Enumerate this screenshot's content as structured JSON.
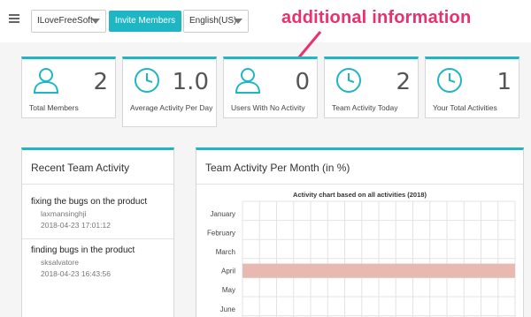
{
  "header": {
    "team_select": "ILoveFreeSoft",
    "invite_button": "Invite Members",
    "language_select": "English(US)"
  },
  "annotation": "additional information",
  "stats": [
    {
      "value": "2",
      "label": "Total Members",
      "icon": "user-icon"
    },
    {
      "value": "1.0",
      "label": "Average Activity Per Day",
      "icon": "clock-icon"
    },
    {
      "value": "0",
      "label": "Users With No Activity",
      "icon": "user-icon"
    },
    {
      "value": "2",
      "label": "Team Activity Today",
      "icon": "clock-icon"
    },
    {
      "value": "1",
      "label": "Your Total Activities",
      "icon": "clock-icon"
    }
  ],
  "recent": {
    "title": "Recent Team Activity",
    "items": [
      {
        "title": "fixing the bugs on the product",
        "user": "laxmansinghji",
        "time": "2018-04-23 17:01:12"
      },
      {
        "title": "finding bugs in the product",
        "user": "sksalvatore",
        "time": "2018-04-23 16:43:56"
      }
    ]
  },
  "monthly": {
    "title": "Team Activity Per Month (in %)"
  },
  "colors": {
    "accent": "#1fb6c4",
    "annotation": "#e8316d",
    "bar": "#e7b9b1"
  },
  "chart_data": {
    "type": "bar",
    "orientation": "horizontal",
    "title": "Activity chart based on all activities (2018)",
    "categories": [
      "January",
      "February",
      "March",
      "April",
      "May",
      "June"
    ],
    "values": [
      0,
      0,
      0,
      100,
      0,
      0
    ],
    "xlim": [
      0,
      100
    ],
    "grid": true
  }
}
